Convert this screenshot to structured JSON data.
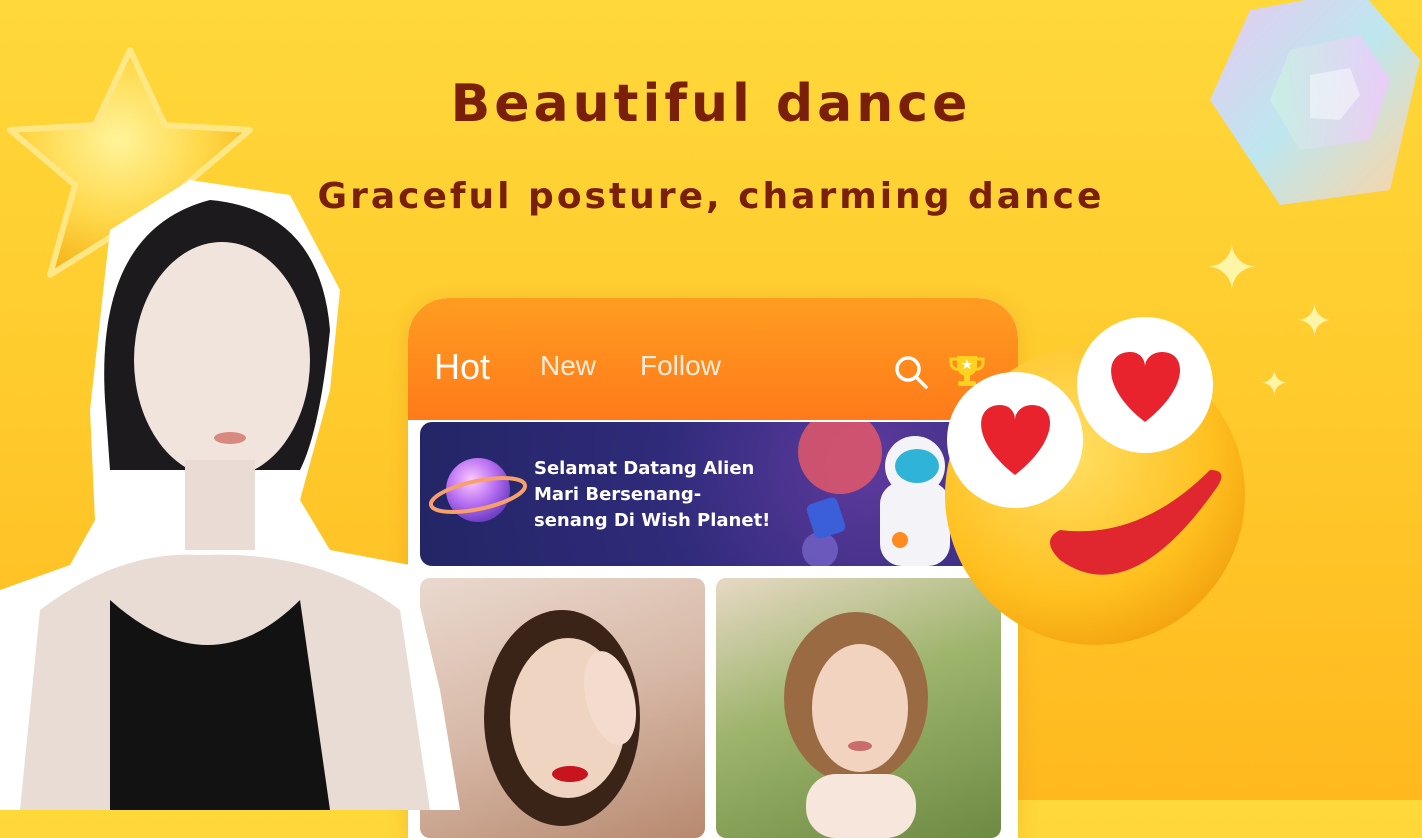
{
  "headline": {
    "title": "Beautiful dance",
    "subtitle": "Graceful posture, charming dance"
  },
  "phone": {
    "tabs": [
      {
        "label": "Hot",
        "active": true
      },
      {
        "label": "New",
        "active": false
      },
      {
        "label": "Follow",
        "active": false
      }
    ],
    "icons": {
      "search": "search-icon",
      "trophy": "trophy-icon"
    },
    "banner": {
      "lines": [
        "Selamat Datang Alien",
        "Mari Bersenang-",
        "senang Di Wish Planet!"
      ]
    }
  },
  "colors": {
    "background": "#ffc92b",
    "headline_text": "#7a1f0a",
    "header_orange": "#ff8a1e",
    "banner_purple": "#2f2b7a"
  }
}
